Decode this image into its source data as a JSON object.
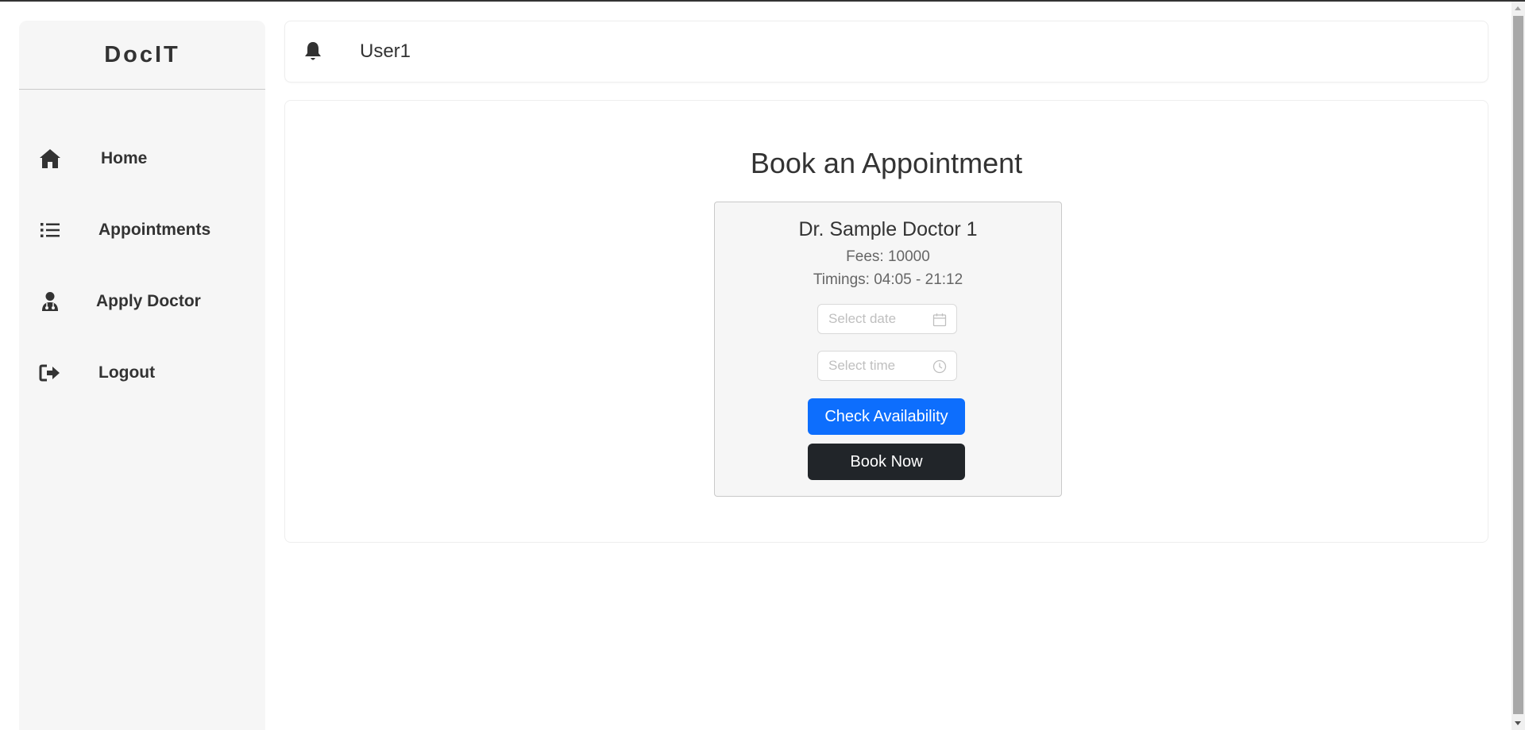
{
  "app": {
    "brand": "DocIT"
  },
  "sidebar": {
    "items": [
      {
        "label": "Home",
        "icon": "home-icon"
      },
      {
        "label": "Appointments",
        "icon": "list-icon"
      },
      {
        "label": "Apply Doctor",
        "icon": "doctor-icon"
      },
      {
        "label": "Logout",
        "icon": "logout-icon"
      }
    ]
  },
  "header": {
    "username": "User1",
    "icon": "bell-icon"
  },
  "main": {
    "title": "Book an Appointment",
    "doctor": {
      "name": "Dr. Sample Doctor 1",
      "fees": "Fees: 10000",
      "timings": "Timings: 04:05 - 21:12"
    },
    "date_field": {
      "placeholder": "Select date",
      "icon": "calendar-icon"
    },
    "time_field": {
      "placeholder": "Select time",
      "icon": "clock-icon"
    },
    "check_label": "Check Availability",
    "book_label": "Book Now"
  },
  "colors": {
    "sidebar_bg": "#f6f6f6",
    "primary": "#0d6efd",
    "dark": "#212529",
    "text": "#333333"
  }
}
